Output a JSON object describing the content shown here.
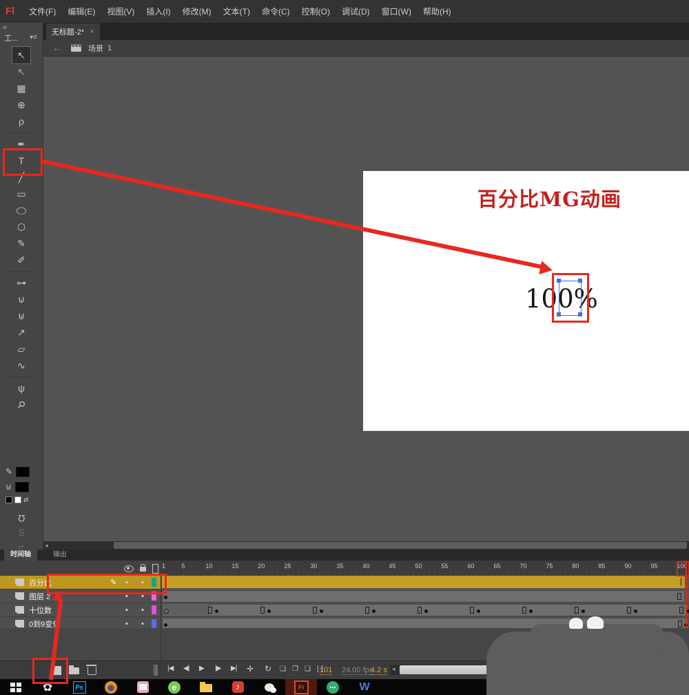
{
  "menubar": {
    "logo": "Fl",
    "items": [
      "文件(F)",
      "编辑(E)",
      "视图(V)",
      "插入(I)",
      "修改(M)",
      "文本(T)",
      "命令(C)",
      "控制(O)",
      "调试(D)",
      "窗口(W)",
      "帮助(H)"
    ]
  },
  "document_tab": {
    "label": "无标题-2*",
    "close_glyph": "×"
  },
  "scene_bar": {
    "back_glyph": "←",
    "scene_label": "场景",
    "scene_number": "1"
  },
  "tools_panel": {
    "collapse_glyph": "«",
    "header": "工...",
    "panel_menu_glyph": "▾≡",
    "tools": [
      {
        "name": "selection-tool",
        "glyph": "↖",
        "selected": true
      },
      {
        "name": "subselection-tool",
        "glyph": "↖",
        "variant": "outline"
      },
      {
        "name": "free-transform-tool",
        "glyph": "▦"
      },
      {
        "name": "3d-rotation-tool",
        "glyph": "⊕"
      },
      {
        "name": "lasso-tool",
        "glyph": "ρ"
      },
      {
        "divider": true
      },
      {
        "name": "pen-tool",
        "glyph": "✒"
      },
      {
        "name": "text-tool",
        "glyph": "T",
        "highlight": true
      },
      {
        "name": "line-tool",
        "glyph": "╱"
      },
      {
        "name": "rectangle-tool",
        "glyph": "▭"
      },
      {
        "name": "oval-tool",
        "glyph": "◯",
        "variant": "squash"
      },
      {
        "name": "polystar-tool",
        "glyph": "⬡"
      },
      {
        "name": "pencil-tool",
        "glyph": "✎"
      },
      {
        "name": "brush-tool",
        "glyph": "✐"
      },
      {
        "divider": true
      },
      {
        "name": "bone-tool",
        "glyph": "⊶"
      },
      {
        "name": "paint-bucket-tool",
        "glyph": "⊍"
      },
      {
        "name": "ink-bottle-tool",
        "glyph": "⊎"
      },
      {
        "name": "eyedropper-tool",
        "glyph": "↗"
      },
      {
        "name": "eraser-tool",
        "glyph": "▱"
      },
      {
        "name": "deco-tool",
        "glyph": "∿"
      },
      {
        "divider": true
      },
      {
        "name": "hand-tool",
        "glyph": "ψ"
      },
      {
        "name": "zoom-tool",
        "glyph": "⚲",
        "variant": "rot45"
      }
    ],
    "stroke_swatch": "#000000",
    "fill_swatch": "#000000",
    "magnet_glyph": "Ω",
    "smooth_glyph": "S",
    "straighten_glyph": "⌐"
  },
  "stage": {
    "title": "百分比MG动画",
    "title_color": "#c3201d",
    "percent_text": "100%"
  },
  "timeline": {
    "tabs": [
      {
        "label": "时间轴",
        "active": true
      },
      {
        "label": "输出",
        "active": false
      }
    ],
    "ruler_numbers": [
      1,
      5,
      10,
      15,
      20,
      25,
      30,
      35,
      40,
      45,
      50,
      55,
      60,
      65,
      70,
      75,
      80,
      85,
      90,
      95,
      100
    ],
    "playhead_frame": 101,
    "layers": [
      {
        "name": "百分比",
        "color": "#17a08a",
        "selected": true,
        "editing": true,
        "track": "tween"
      },
      {
        "name": "图层 2",
        "color": "#ef5fef",
        "track": "static"
      },
      {
        "name": "十位数",
        "color": "#e14fe1",
        "track": "keyframes",
        "keyframes": [
          10,
          20,
          30,
          40,
          50,
          60,
          70,
          80,
          90,
          100
        ]
      },
      {
        "name": "0到9变化",
        "color": "#5b6ced",
        "track": "static-end"
      }
    ],
    "buttons": {
      "playback": [
        {
          "name": "first-frame-button",
          "glyph": "|◀"
        },
        {
          "name": "prev-frame-button",
          "glyph": "◀|"
        },
        {
          "name": "play-button",
          "glyph": "▶"
        },
        {
          "name": "next-frame-button",
          "glyph": "|▶"
        },
        {
          "name": "last-frame-button",
          "glyph": "▶|"
        }
      ],
      "center_frame_glyph": "✛",
      "loop_glyph": "↻",
      "onion": [
        {
          "name": "onion-skin-button",
          "glyph": "❏"
        },
        {
          "name": "onion-outline-button",
          "glyph": "❐"
        },
        {
          "name": "edit-multiple-frames-button",
          "glyph": "❑"
        },
        {
          "name": "modify-markers-button",
          "glyph": "[·]"
        }
      ]
    },
    "status": {
      "current_frame": "101",
      "fps": "24.00 fps",
      "elapsed": "4.2 s"
    }
  },
  "hscroll": {
    "arrow_glyph": "◂"
  },
  "taskbar": {
    "items": [
      {
        "name": "windows-start"
      },
      {
        "name": "media-app",
        "glyph": "✿"
      },
      {
        "name": "photoshop",
        "label": "Ps"
      },
      {
        "name": "firefox"
      },
      {
        "name": "image-app"
      },
      {
        "name": "browser-app",
        "label": "e"
      },
      {
        "name": "folder"
      },
      {
        "name": "netease-music",
        "label": "♪"
      },
      {
        "name": "wechat"
      },
      {
        "name": "flash",
        "label": "Fl",
        "active": true
      },
      {
        "name": "green-app"
      },
      {
        "name": "wps",
        "label": "W"
      }
    ]
  },
  "annotations": {
    "accent": "#e8281e"
  }
}
